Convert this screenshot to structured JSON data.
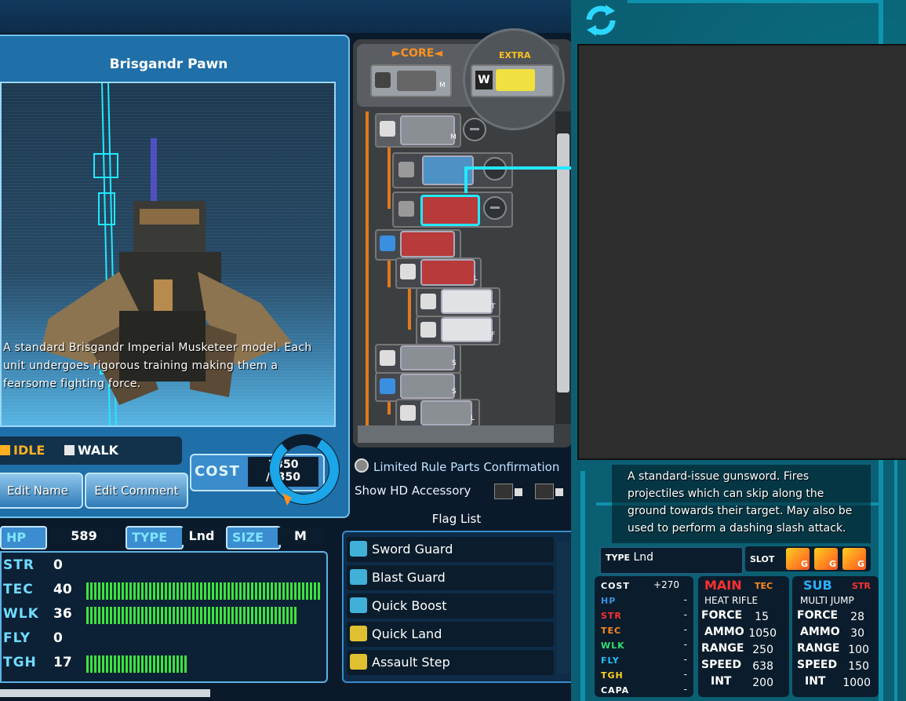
{
  "unit": {
    "name": "Brisgandr Pawn",
    "description": "A standard Brisgandr Imperial Musketeer model. Each unit undergoes rigorous training making them a fearsome fighting force."
  },
  "animation": {
    "idle_label": "IDLE",
    "walk_label": "WALK",
    "selected": "IDLE"
  },
  "buttons": {
    "edit_name": "Edit Name",
    "edit_comment": "Edit Comment"
  },
  "cost": {
    "label": "COST",
    "current": "1350",
    "max": "/1350",
    "fill_fraction": 1.0
  },
  "stats": {
    "hp_label": "HP",
    "hp": "589",
    "type_label": "TYPE",
    "type": "Lnd",
    "size_label": "SIZE",
    "size": "M",
    "rows": [
      {
        "label": "STR",
        "value": "0",
        "fill": 0
      },
      {
        "label": "TEC",
        "value": "40",
        "fill": 40
      },
      {
        "label": "WLK",
        "value": "36",
        "fill": 36
      },
      {
        "label": "FLY",
        "value": "0",
        "fill": 0
      },
      {
        "label": "TGH",
        "value": "17",
        "fill": 17
      }
    ],
    "bar_max": 40
  },
  "parts": {
    "core_label": "CORE",
    "extra_label": "EXTRA",
    "extra_key": "W",
    "size_badges": [
      "M",
      "M",
      "M",
      "L",
      "T",
      "F",
      "S",
      "S",
      "L"
    ]
  },
  "options": {
    "limited_rule": "Limited Rule Parts Confirmation",
    "show_hd": "Show HD Accessory"
  },
  "flags": {
    "title": "Flag List",
    "items": [
      "Sword Guard",
      "Blast Guard",
      "Quick Boost",
      "Quick Land",
      "Assault Step"
    ]
  },
  "part_info": {
    "description": "A standard-issue gunsword. Fires projectiles which can skip along the ground towards their target. May also be used to perform a dashing slash attack.",
    "type_label": "TYPE",
    "type": "Lnd",
    "slot_label": "SLOT",
    "slot_badge": "G",
    "side_stats": [
      {
        "label": "COST",
        "value": "+270",
        "color": "#ffffff"
      },
      {
        "label": "HP",
        "value": "-",
        "color": "#3a8fe0"
      },
      {
        "label": "STR",
        "value": "-",
        "color": "#ff3030"
      },
      {
        "label": "TEC",
        "value": "-",
        "color": "#ff8a20"
      },
      {
        "label": "WLK",
        "value": "-",
        "color": "#30e070"
      },
      {
        "label": "FLY",
        "value": "-",
        "color": "#20c0ff"
      },
      {
        "label": "TGH",
        "value": "-",
        "color": "#ffd020"
      },
      {
        "label": "CAPA",
        "value": "-",
        "color": "#ffffff"
      }
    ],
    "main": {
      "label": "MAIN",
      "tag": "TEC",
      "weapon": "HEAT RIFLE",
      "rows": [
        {
          "label": "FORCE",
          "value": "15"
        },
        {
          "label": "AMMO",
          "value": "1050"
        },
        {
          "label": "RANGE",
          "value": "250"
        },
        {
          "label": "SPEED",
          "value": "638"
        },
        {
          "label": "INT",
          "value": "200"
        }
      ]
    },
    "sub": {
      "label": "SUB",
      "tag": "STR",
      "weapon": "MULTI JUMP",
      "rows": [
        {
          "label": "FORCE",
          "value": "28"
        },
        {
          "label": "AMMO",
          "value": "30"
        },
        {
          "label": "RANGE",
          "value": "100"
        },
        {
          "label": "SPEED",
          "value": "150"
        },
        {
          "label": "INT",
          "value": "1000"
        }
      ]
    }
  },
  "colors": {
    "accent": "#6fc3ef",
    "bar_green": "#3de33d",
    "tree_orange": "#e07a1a",
    "panel_teal": "#0b5f73"
  }
}
